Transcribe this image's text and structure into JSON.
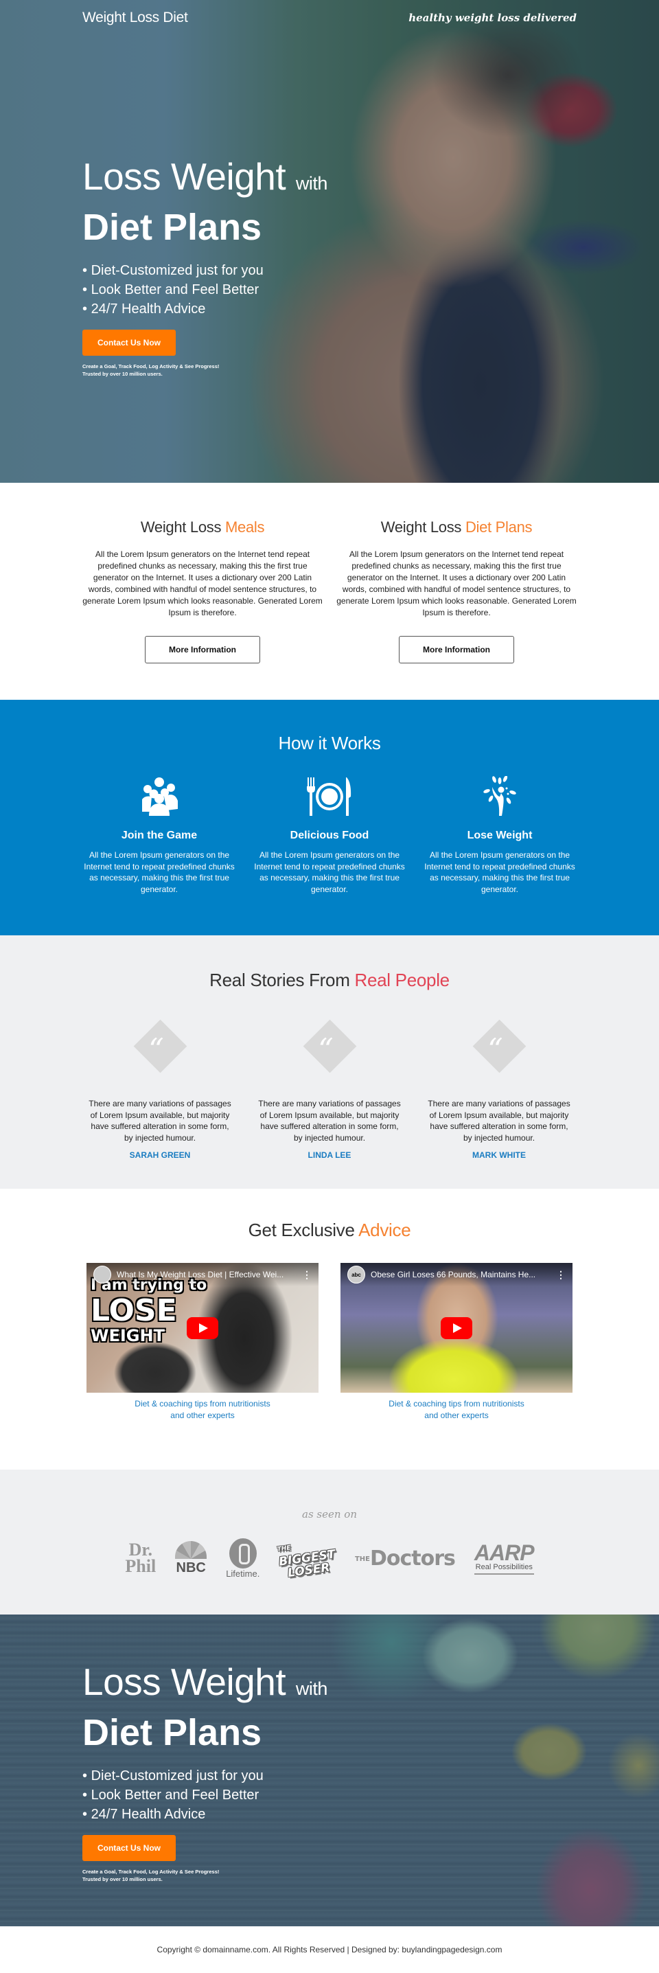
{
  "colors": {
    "accent_orange": "#ff7800",
    "heading_accent": "#f58231",
    "brand_blue": "#0181c6",
    "link_blue": "#1a7cc1",
    "real_people_red": "#e14455",
    "light_gray_bg": "#eff0f2"
  },
  "header": {
    "brand": "Weight Loss Diet",
    "tagline": "healthy weight loss delivered"
  },
  "hero": {
    "headline_light": "Loss Weight",
    "headline_small": "with",
    "headline_bold": "Diet Plans",
    "bullets": [
      "Diet-Customized just for you",
      "Look Better and Feel Better",
      "24/7 Health Advice"
    ],
    "cta_label": "Contact Us Now",
    "fine_print_1": "Create a Goal, Track Food, Log Activity & See Progress!",
    "fine_print_2": "Trusted by over 10 million users."
  },
  "info": {
    "columns": [
      {
        "title_main": "Weight Loss ",
        "title_accent": "Meals",
        "body": "All the Lorem Ipsum generators on the Internet tend repeat predefined chunks as necessary, making this the first true generator on the Internet. It uses a dictionary over 200 Latin words, combined with handful of model sentence structures, to generate Lorem Ipsum which looks reasonable. Generated Lorem Ipsum is therefore.",
        "button": "More Information"
      },
      {
        "title_main": "Weight Loss ",
        "title_accent": "Diet Plans",
        "body": "All the Lorem Ipsum generators on the Internet tend repeat predefined chunks as necessary, making this the first true generator on the Internet. It uses a dictionary over 200 Latin words, combined with handful of model sentence structures, to generate Lorem Ipsum which looks reasonable. Generated Lorem Ipsum is therefore.",
        "button": "More Information"
      }
    ]
  },
  "how": {
    "title": "How it Works",
    "items": [
      {
        "icon": "group-icon",
        "title": "Join the Game",
        "body": "All the Lorem Ipsum generators on the Internet tend to repeat predefined chunks as necessary, making this the first true generator."
      },
      {
        "icon": "plate-cutlery-icon",
        "title": "Delicious Food",
        "body": "All the Lorem Ipsum generators on the Internet tend to repeat predefined chunks as necessary, making this the first true generator."
      },
      {
        "icon": "growth-tree-icon",
        "title": "Lose Weight",
        "body": "All the Lorem Ipsum generators on the Internet tend to repeat predefined chunks as necessary, making this the first true generator."
      }
    ]
  },
  "stories": {
    "title_main": "Real Stories From ",
    "title_accent": "Real People",
    "quote_glyph": "“",
    "items": [
      {
        "text": "There are many variations of passages of Lorem Ipsum available, but majority have suffered alteration in some form, by injected humour.",
        "author": "SARAH GREEN"
      },
      {
        "text": "There are many variations of passages of Lorem Ipsum available, but majority have suffered alteration in some form, by injected humour.",
        "author": "LINDA LEE"
      },
      {
        "text": "There are many variations of passages of Lorem Ipsum available, but majority have suffered alteration in some form, by injected humour.",
        "author": "MARK WHITE"
      }
    ]
  },
  "advice": {
    "title_main": "Get Exclusive ",
    "title_accent": "Advice",
    "videos": [
      {
        "title": "What Is My Weight Loss Diet | Effective Wei...",
        "thumb_lines": [
          "I am trying to",
          "LOSE",
          "WEIGHT"
        ],
        "caption_1": "Diet & coaching tips from nutritionists",
        "caption_2": "and other experts"
      },
      {
        "title": "Obese Girl Loses 66 Pounds, Maintains He...",
        "channel_badge": "abc",
        "caption_1": "Diet & coaching tips from nutritionists",
        "caption_2": "and other experts"
      }
    ],
    "more_glyph": "⋮"
  },
  "seen": {
    "label": "as seen on",
    "logos": {
      "drphil_1": "Dr.",
      "drphil_2": "Phil",
      "nbc": "NBC",
      "lifetime": "Lifetime.",
      "biggest_the": "THE",
      "biggest_1": "BIGGEST",
      "biggest_2": "LOSER",
      "doctors_the": "THE",
      "doctors": "Doctors",
      "aarp": "AARP",
      "aarp_sub": "Real Possibilities"
    }
  },
  "hero2": {
    "headline_light": "Loss Weight",
    "headline_small": "with",
    "headline_bold": "Diet Plans",
    "bullets": [
      "Diet-Customized just for you",
      "Look Better and Feel Better",
      "24/7 Health Advice"
    ],
    "cta_label": "Contact Us Now",
    "fine_print_1": "Create a Goal, Track Food, Log Activity & See Progress!",
    "fine_print_2": "Trusted by over 10 million users."
  },
  "footer": {
    "text": "Copyright © domainname.com. All Rights Reserved | Designed by: buylandingpagedesign.com"
  }
}
